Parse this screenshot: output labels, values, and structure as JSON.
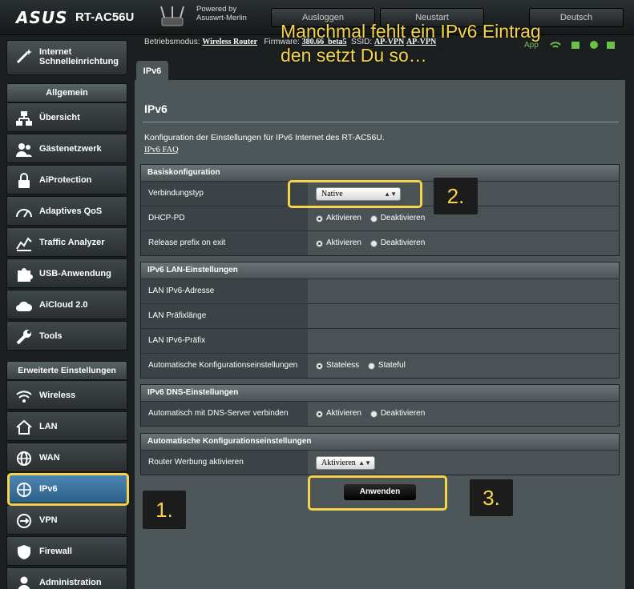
{
  "header": {
    "logo": "ASUS",
    "model": "RT-AC56U",
    "powered_by_1": "Powered by",
    "powered_by_2": "Asuswrt-Merlin",
    "logout": "Ausloggen",
    "reboot": "Neustart",
    "language": "Deutsch"
  },
  "status": {
    "mode_label": "Betriebsmodus:",
    "mode_value": "Wireless Router",
    "firmware_label": "Firmware:",
    "firmware_value": "380.66_beta5",
    "ssid_label": "SSID:",
    "ssid_1": "AP-VPN",
    "ssid_2": "AP-VPN",
    "app": "App"
  },
  "sidebar": {
    "qis": "Internet Schnelleinrichtung",
    "general_title": "Allgemein",
    "general": [
      "Übersicht",
      "Gästenetzwerk",
      "AiProtection",
      "Adaptives QoS",
      "Traffic Analyzer",
      "USB-Anwendung",
      "AiCloud 2.0",
      "Tools"
    ],
    "advanced_title": "Erweiterte Einstellungen",
    "advanced": [
      "Wireless",
      "LAN",
      "WAN",
      "IPv6",
      "VPN",
      "Firewall",
      "Administration"
    ]
  },
  "main": {
    "tab": "IPv6",
    "title": "IPv6",
    "description": "Konfiguration der Einstellungen für IPv6 Internet des RT-AC56U.",
    "faq": "IPv6 FAQ",
    "basic": {
      "header": "Basiskonfiguration",
      "conn_type_label": "Verbindungstyp",
      "conn_type_value": "Native",
      "dhcp_pd_label": "DHCP-PD",
      "release_label": "Release prefix on exit",
      "enable": "Aktivieren",
      "disable": "Deaktivieren"
    },
    "lan": {
      "header": "IPv6 LAN-Einstellungen",
      "addr_label": "LAN IPv6-Adresse",
      "prefix_len_label": "LAN Präfixlänge",
      "prefix_label": "LAN IPv6-Präfix",
      "autoconf_label": "Automatische Konfigurationseinstellungen",
      "stateless": "Stateless",
      "stateful": "Stateful"
    },
    "dns": {
      "header": "IPv6 DNS-Einstellungen",
      "auto_label": "Automatisch mit DNS-Server verbinden"
    },
    "autoconf": {
      "header": "Automatische Konfigurationseinstellungen",
      "ra_label": "Router Werbung aktivieren",
      "ra_value": "Aktivieren"
    },
    "apply": "Anwenden"
  },
  "annotation": {
    "line1": "Manchmal fehlt ein IPv6 Eintrag",
    "line2": "den setzt Du so…",
    "step1": "1.",
    "step2": "2.",
    "step3": "3."
  },
  "colors": {
    "accent": "#f7d34b",
    "active_nav": "#3a72a0"
  }
}
